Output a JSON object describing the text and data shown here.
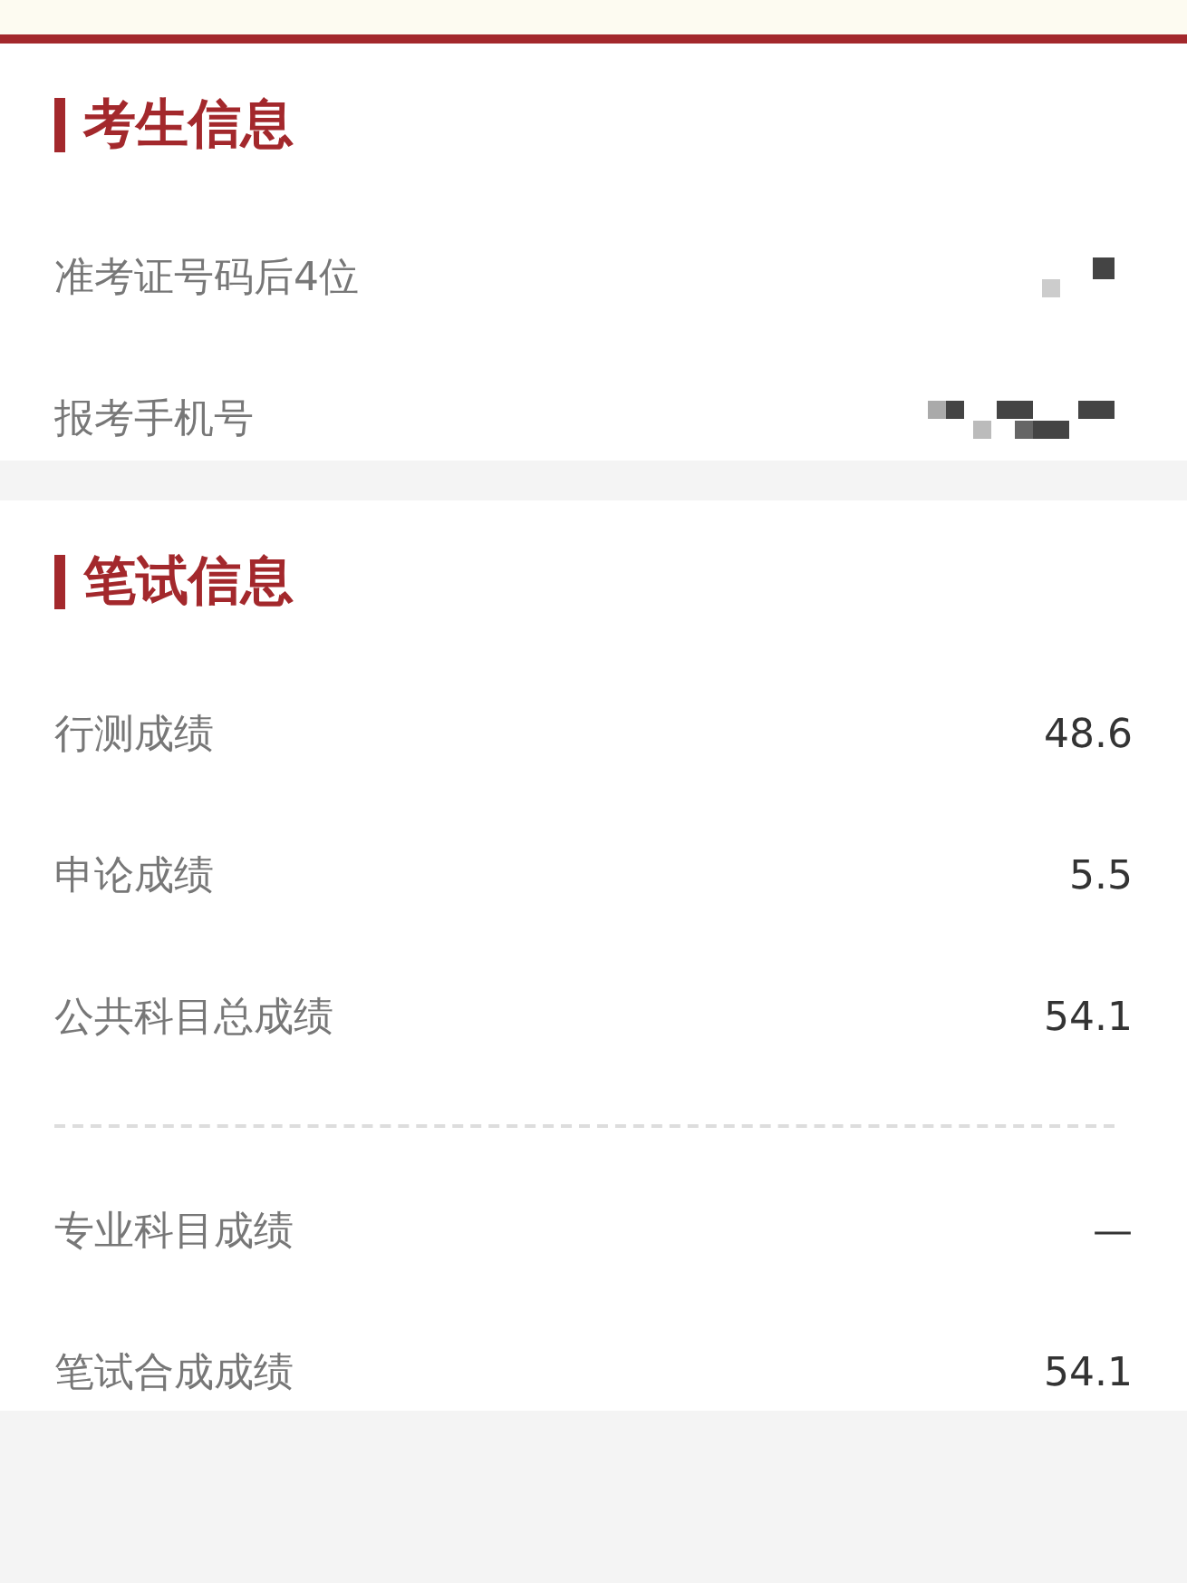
{
  "sections": [
    {
      "title": "考生信息",
      "rows": [
        {
          "label": "准考证号码后4位",
          "kind": "masked"
        },
        {
          "label": "报考手机号",
          "kind": "masked"
        }
      ]
    },
    {
      "title": "笔试信息",
      "rows": [
        {
          "label": "行测成绩",
          "kind": "value",
          "value": "48.6"
        },
        {
          "label": "申论成绩",
          "kind": "value",
          "value": "5.5"
        },
        {
          "label": "公共科目总成绩",
          "kind": "value",
          "value": "54.1"
        },
        {
          "kind": "divider"
        },
        {
          "label": "专业科目成绩",
          "kind": "value",
          "value": "—"
        },
        {
          "label": "笔试合成成绩",
          "kind": "value",
          "value": "54.1"
        }
      ]
    }
  ]
}
